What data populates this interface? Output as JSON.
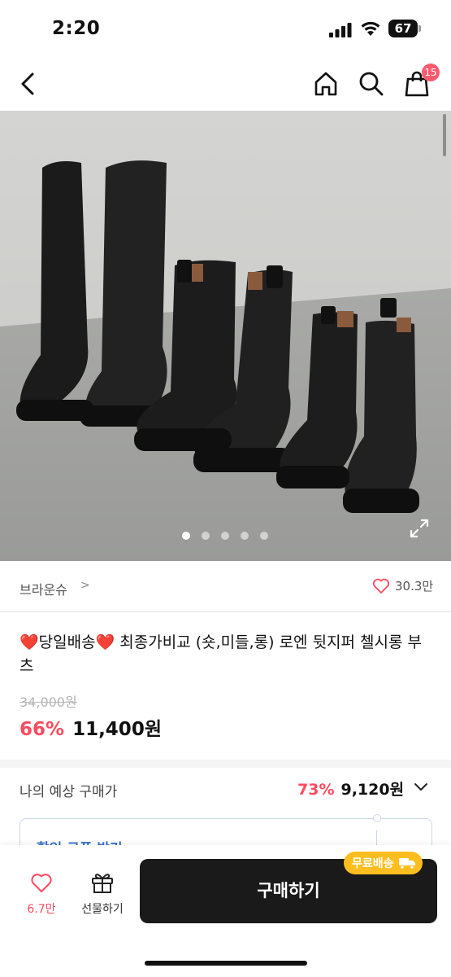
{
  "status_bar": {
    "time": "2:20",
    "battery": "67"
  },
  "nav": {
    "cart_count": "15"
  },
  "gallery": {
    "total_images": 5,
    "current_index": 1
  },
  "brand": {
    "name": "브라운슈",
    "chevron": ">",
    "likes": "30.3만"
  },
  "product": {
    "title": "❤️당일배송❤️ 최종가비교 (숏,미들,롱) 로엔 뒷지퍼 첼시롱 부츠",
    "original_price": "34,000원",
    "discount": "66%",
    "price": "11,400원"
  },
  "my_price": {
    "label": "나의 예상 구매가",
    "discount": "73%",
    "price": "9,120원"
  },
  "coupon": {
    "label": "할인 쿠폰 받기"
  },
  "bottom_bar": {
    "like_count": "6.7만",
    "gift_label": "선물하기",
    "buy_label": "구매하기",
    "free_shipping": "무료배송"
  },
  "colors": {
    "accent": "#ff4a5f",
    "buy_button": "#1a1a1a",
    "free_shipping": "#ffbe1f",
    "coupon": "#3b73c9"
  }
}
